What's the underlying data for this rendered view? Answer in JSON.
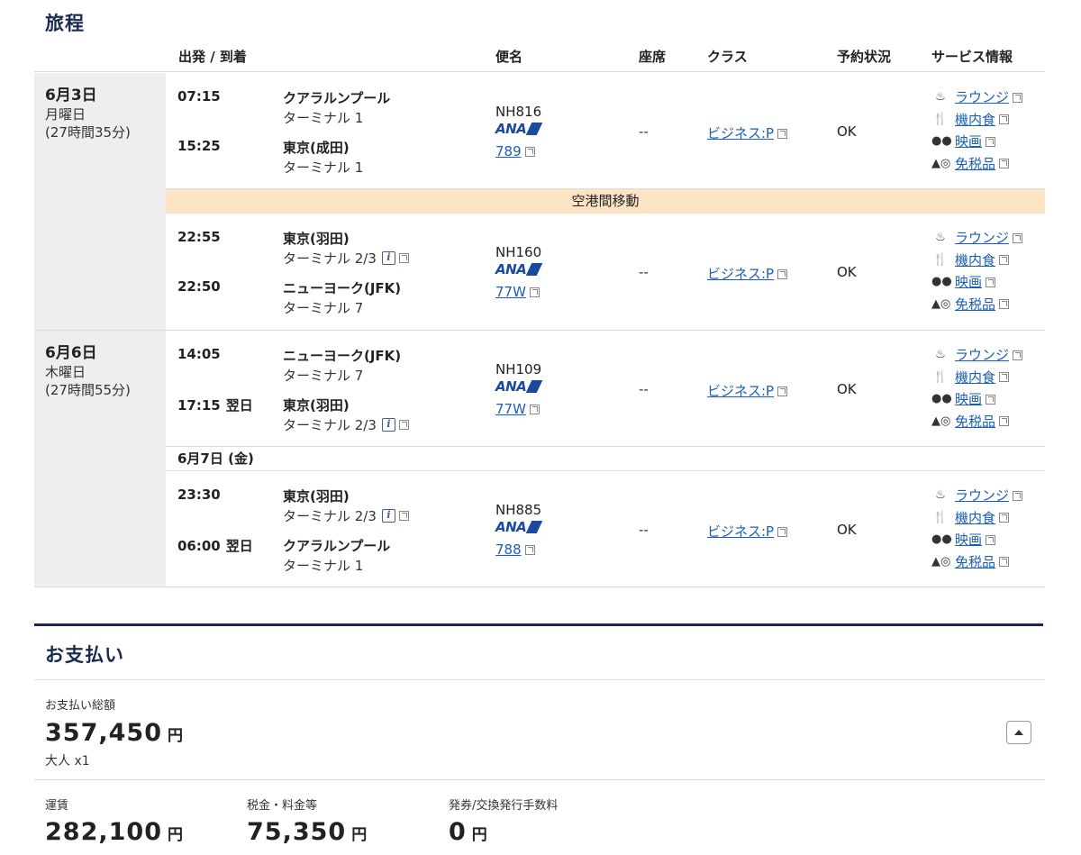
{
  "itinerary": {
    "title": "旅程",
    "headers": {
      "depart_arrive": "出発 / 到着",
      "flight": "便名",
      "seat": "座席",
      "class": "クラス",
      "status": "予約状況",
      "services": "サービス情報"
    },
    "days": [
      {
        "date": "6月3日",
        "weekday": "月曜日",
        "duration": "(27時間35分)"
      },
      {
        "date": "6月6日",
        "weekday": "木曜日",
        "duration": "(27時間55分)"
      }
    ],
    "transfer_label": "空港間移動",
    "date_separator": "6月7日 (金)",
    "airline_logo": "ANA",
    "service_labels": {
      "lounge": "ラウンジ",
      "meal": "機内食",
      "movie": "映画",
      "dutyfree": "免税品"
    },
    "segments": [
      {
        "dep_time": "07:15",
        "dep_city": "クアラルンプール",
        "dep_terminal": "ターミナル 1",
        "arr_time": "15:25",
        "arr_next": "",
        "arr_city": "東京(成田)",
        "arr_terminal": "ターミナル 1",
        "flight_no": "NH816",
        "aircraft": "789",
        "seat": "--",
        "class": "ビジネス:P",
        "status": "OK"
      },
      {
        "dep_time": "22:55",
        "dep_city": "東京(羽田)",
        "dep_terminal": "ターミナル 2/3",
        "arr_time": "22:50",
        "arr_next": "",
        "arr_city": "ニューヨーク(JFK)",
        "arr_terminal": "ターミナル 7",
        "flight_no": "NH160",
        "aircraft": "77W",
        "seat": "--",
        "class": "ビジネス:P",
        "status": "OK"
      },
      {
        "dep_time": "14:05",
        "dep_city": "ニューヨーク(JFK)",
        "dep_terminal": "ターミナル 7",
        "arr_time": "17:15",
        "arr_next": "翌日",
        "arr_city": "東京(羽田)",
        "arr_terminal": "ターミナル 2/3",
        "flight_no": "NH109",
        "aircraft": "77W",
        "seat": "--",
        "class": "ビジネス:P",
        "status": "OK"
      },
      {
        "dep_time": "23:30",
        "dep_city": "東京(羽田)",
        "dep_terminal": "ターミナル 2/3",
        "arr_time": "06:00",
        "arr_next": "翌日",
        "arr_city": "クアラルンプール",
        "arr_terminal": "ターミナル 1",
        "flight_no": "NH885",
        "aircraft": "788",
        "seat": "--",
        "class": "ビジネス:P",
        "status": "OK"
      }
    ]
  },
  "payment": {
    "title": "お支払い",
    "total_label": "お支払い総額",
    "total_value": "357,450",
    "currency": "円",
    "passengers": "大人 x1",
    "fare_label": "運賃",
    "fare_value": "282,100",
    "tax_label": "税金・料金等",
    "tax_value": "75,350",
    "fee_label": "発券/交換発行手数料",
    "fee_value": "0"
  }
}
